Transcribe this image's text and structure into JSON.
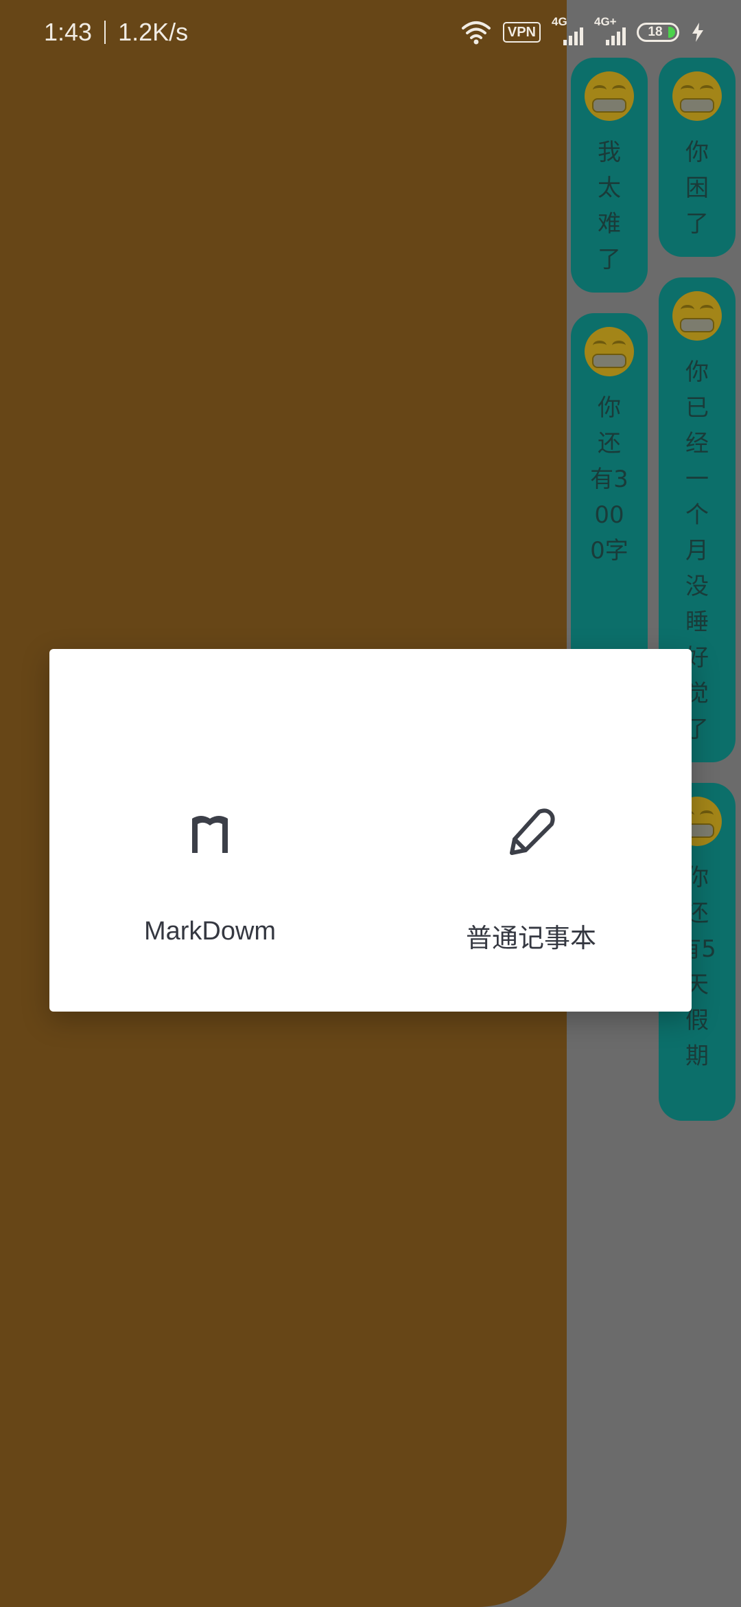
{
  "status_bar": {
    "time": "1:43",
    "net_speed": "1.2K/s",
    "vpn": "VPN",
    "signal_1": "4G",
    "signal_2": "4G+",
    "battery": "18"
  },
  "notes": [
    {
      "text": "我太难了"
    },
    {
      "text": "你困了"
    },
    {
      "text": "你还有3000字"
    },
    {
      "text": "你已经一个月没睡好觉了"
    },
    {
      "text": "你还有5天假期"
    }
  ],
  "dialog": {
    "option_markdown": {
      "label": "MarkDowm",
      "icon": "markdown-icon"
    },
    "option_plain": {
      "label": "普通记事本",
      "icon": "pencil-icon"
    }
  },
  "colors": {
    "drawer": "#674617",
    "note_card": "#0c6f6a",
    "scrim": "#6b6b6b",
    "dialog_text": "#353841"
  }
}
